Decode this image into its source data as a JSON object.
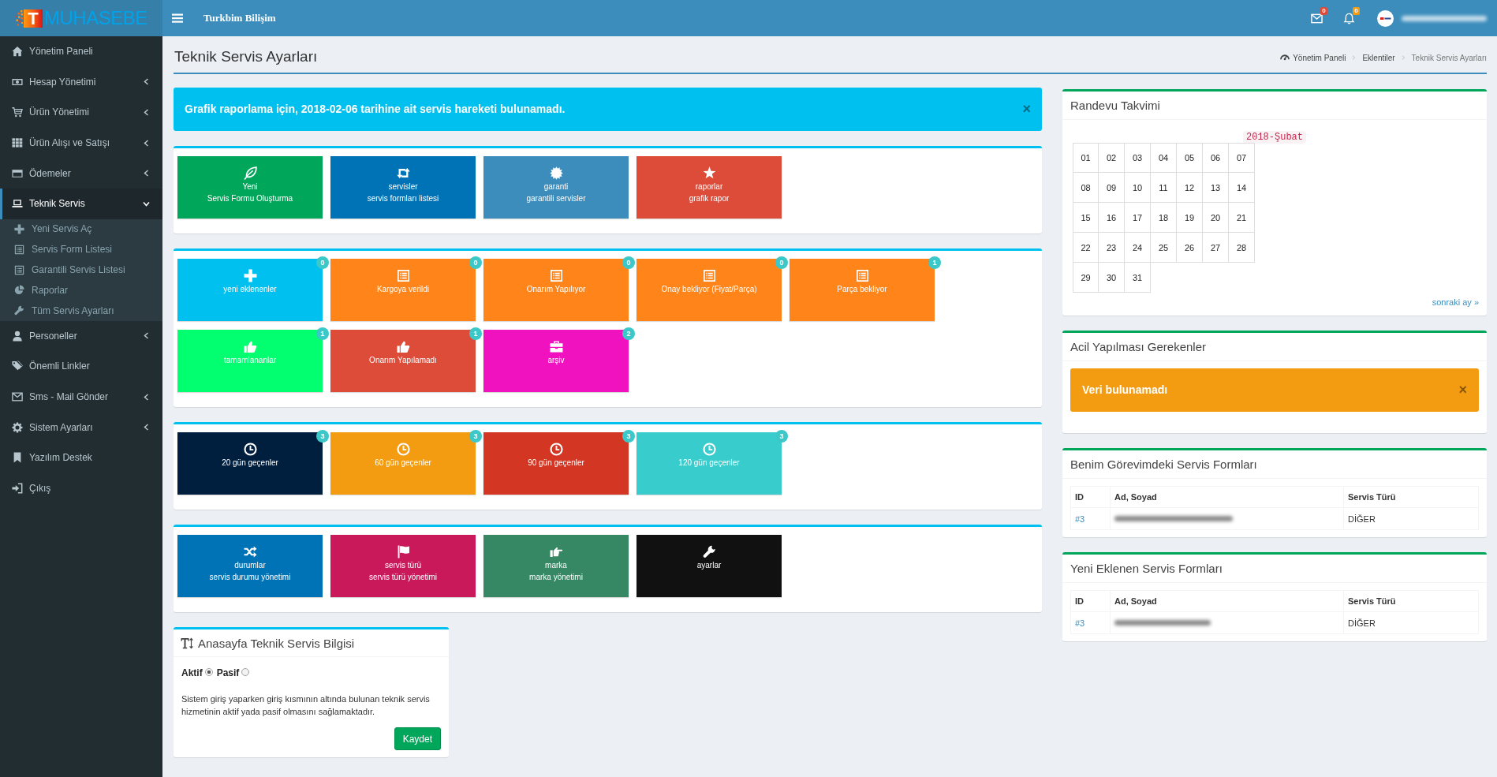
{
  "header": {
    "logo": {
      "mark": "T",
      "text": "MUHASEBE"
    },
    "company": "Turkbim Bilişim",
    "notifications": [
      {
        "badge": "0",
        "color": "#dd4b39"
      },
      {
        "badge": "0",
        "color": "#f39c12"
      }
    ]
  },
  "sidebar": {
    "items": [
      {
        "label": "Yönetim Paneli",
        "kind": "link",
        "selected": false
      },
      {
        "label": "Hesap Yönetimi",
        "kind": "menu",
        "expanded": false,
        "selected": false
      },
      {
        "label": "Ürün Yönetimi",
        "kind": "menu",
        "expanded": false,
        "selected": false
      },
      {
        "label": "Ürün Alışı ve Satışı",
        "kind": "menu",
        "expanded": false,
        "selected": false
      },
      {
        "label": "Ödemeler",
        "kind": "menu",
        "expanded": false,
        "selected": false
      },
      {
        "label": "Teknik Servis",
        "kind": "menu",
        "expanded": true,
        "selected": true,
        "children": [
          {
            "label": "Yeni Servis Aç",
            "selected": false
          },
          {
            "label": "Servis Form Listesi",
            "selected": false
          },
          {
            "label": "Garantili Servis Listesi",
            "selected": false
          },
          {
            "label": "Raporlar",
            "selected": false
          },
          {
            "label": "Tüm Servis Ayarları",
            "selected": false
          }
        ]
      },
      {
        "label": "Personeller",
        "kind": "menu",
        "expanded": false,
        "selected": false
      },
      {
        "label": "Önemli Linkler",
        "kind": "link",
        "selected": false
      },
      {
        "label": "Sms - Mail Gönder",
        "kind": "menu",
        "expanded": false,
        "selected": false
      },
      {
        "label": "Sistem Ayarları",
        "kind": "menu",
        "expanded": false,
        "selected": false
      },
      {
        "label": "Yazılım Destek",
        "kind": "link",
        "selected": false
      },
      {
        "label": "Çıkış",
        "kind": "link",
        "selected": false
      }
    ]
  },
  "page": {
    "title": "Teknik Servis Ayarları",
    "breadcrumb": [
      {
        "label": "Yönetim Paneli",
        "current": false
      },
      {
        "label": "Eklentiler",
        "current": false
      },
      {
        "label": "Teknik Servis Ayarları",
        "current": true
      }
    ]
  },
  "notice": {
    "text": "Grafik raporlama için, 2018-02-06 tarihine ait servis hareketi bulunamadı.",
    "close": "×"
  },
  "tile_groups": [
    {
      "tiles": [
        {
          "lines": [
            "Yeni",
            "Servis Formu Oluşturma"
          ],
          "color": "#00a65a"
        },
        {
          "lines": [
            "servisler",
            "servis formları listesi"
          ],
          "color": "#0073b7"
        },
        {
          "lines": [
            "garanti",
            "garantili servisler"
          ],
          "color": "#3c8dbc"
        },
        {
          "lines": [
            "raporlar",
            "grafik rapor"
          ],
          "color": "#dd4b39"
        }
      ]
    },
    {
      "tiles": [
        {
          "lines": [
            "yeni eklenenler"
          ],
          "color": "#00c0ef",
          "badge": "0"
        },
        {
          "lines": [
            "Kargoya verildi"
          ],
          "color": "#ff851b",
          "badge": "0"
        },
        {
          "lines": [
            "Onarım Yapılıyor"
          ],
          "color": "#ff851b",
          "badge": "0"
        },
        {
          "lines": [
            "Onay bekliyor (Fiyat/Parça)"
          ],
          "color": "#ff851b",
          "badge": "0"
        },
        {
          "lines": [
            "Parça bekliyor"
          ],
          "color": "#ff851b",
          "badge": "1"
        },
        {
          "lines": [
            "tamamlananlar"
          ],
          "color": "#01ff70",
          "badge": "1"
        },
        {
          "lines": [
            "Onarım Yapılamadı"
          ],
          "color": "#dd4b39",
          "badge": "1"
        },
        {
          "lines": [
            "arşiv"
          ],
          "color": "#f012be",
          "badge": "2"
        }
      ]
    },
    {
      "tiles": [
        {
          "lines": [
            "20 gün geçenler"
          ],
          "color": "#001f3f",
          "badge": "3"
        },
        {
          "lines": [
            "60 gün geçenler"
          ],
          "color": "#f39c12",
          "badge": "3"
        },
        {
          "lines": [
            "90 gün geçenler"
          ],
          "color": "#d33724",
          "badge": "3"
        },
        {
          "lines": [
            "120 gün geçenler"
          ],
          "color": "#39cccc",
          "badge": "3"
        }
      ]
    },
    {
      "tiles": [
        {
          "lines": [
            "durumlar",
            "servis durumu yönetimi"
          ],
          "color": "#0073b7"
        },
        {
          "lines": [
            "servis türü",
            "servis türü yönetimi"
          ],
          "color": "#ca195a"
        },
        {
          "lines": [
            "marka",
            "marka yönetimi"
          ],
          "color": "#368763"
        },
        {
          "lines": [
            "ayarlar"
          ],
          "color": "#111111"
        }
      ]
    }
  ],
  "settings_box": {
    "title": "Anasayfa Teknik Servis Bilgisi",
    "options": [
      {
        "label": "Aktif",
        "selected": true
      },
      {
        "label": "Pasif",
        "selected": false
      }
    ],
    "description": "Sistem giriş yaparken giriş kısmının altında bulunan teknik servis hizmetinin aktif yada pasif olmasını sağlamaktadır.",
    "button": "Kaydet"
  },
  "calendar": {
    "title": "Randevu Takvimi",
    "month": "2018-Şubat",
    "days": [
      "01",
      "02",
      "03",
      "04",
      "05",
      "06",
      "07",
      "08",
      "09",
      "10",
      "11",
      "12",
      "13",
      "14",
      "15",
      "16",
      "17",
      "18",
      "19",
      "20",
      "21",
      "22",
      "23",
      "24",
      "25",
      "26",
      "27",
      "28",
      "29",
      "30",
      "31"
    ],
    "next": "sonraki ay »"
  },
  "urgent": {
    "title": "Acil Yapılması Gerekenler",
    "message": "Veri bulunamadı",
    "close": "×"
  },
  "form_tables": [
    {
      "title": "Benim Görevimdeki Servis Formları",
      "columns": [
        "ID",
        "Ad, Soyad",
        "Servis Türü"
      ],
      "rows": [
        {
          "id": "#3",
          "service_type": "DİĞER"
        }
      ]
    },
    {
      "title": "Yeni Eklenen Servis Formları",
      "columns": [
        "ID",
        "Ad, Soyad",
        "Servis Türü"
      ],
      "rows": [
        {
          "id": "#3",
          "service_type": "DİĞER"
        }
      ]
    }
  ]
}
